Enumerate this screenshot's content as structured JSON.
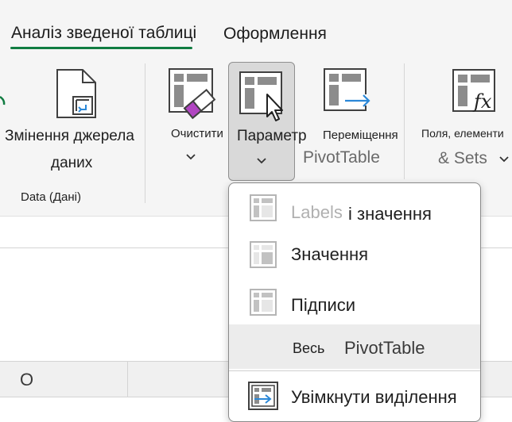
{
  "tabs": {
    "analyze": "Аналіз зведеної таблиці",
    "design": "Оформлення"
  },
  "ribbon": {
    "change_source_line1": "Змінення джерела",
    "change_source_line2": "даних",
    "data_group": "Data (Дані)",
    "clear": "Очистити",
    "parameter": "Параметр",
    "move_line1": "Переміщення",
    "move_line2": "PivotTable",
    "fields_line1": "Поля, елементи",
    "fields_line2": "& Sets"
  },
  "sheet": {
    "column_header": "O"
  },
  "menu": {
    "labels_and_values_ghost": "Labels",
    "labels_and_values": "і значення",
    "values": "Значення",
    "labels": "Підписи",
    "entire_prefix": "Весь",
    "entire_pivot": "PivotTable",
    "enable_selection": "Увімкнути виділення"
  },
  "colors": {
    "accent_green": "#107c41",
    "clear_eraser": "#b146c2",
    "move_arrow": "#2b88d8",
    "highlight": "#ececec"
  }
}
